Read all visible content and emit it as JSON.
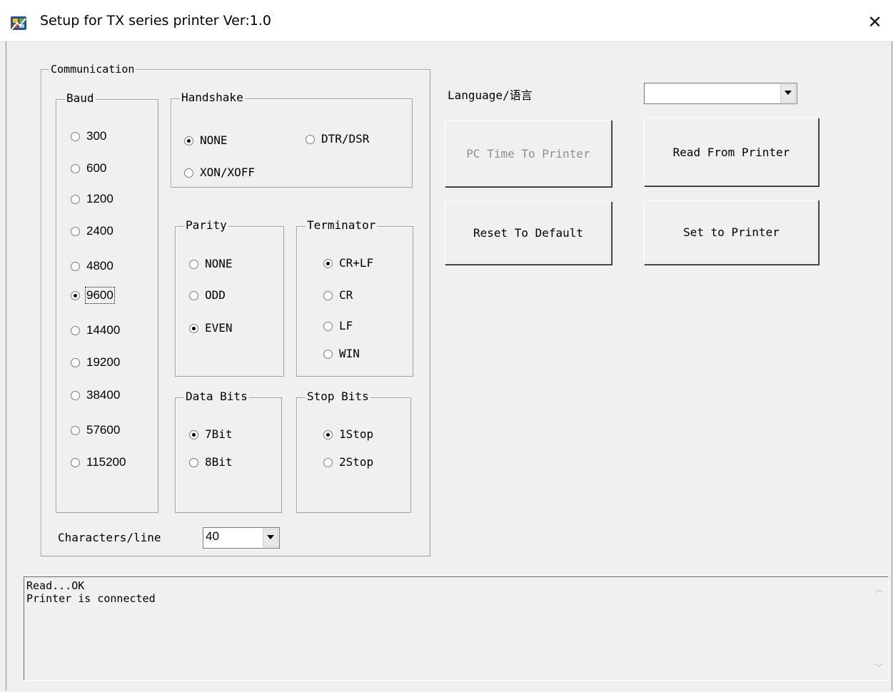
{
  "window": {
    "title": "Setup for TX series printer Ver:1.0",
    "close_glyph": "✕",
    "icon": "printer-app-icon"
  },
  "communication": {
    "caption": "Communication",
    "baud": {
      "caption": "Baud",
      "options": [
        "300",
        "600",
        "1200",
        "2400",
        "4800",
        "9600",
        "14400",
        "19200",
        "38400",
        "57600",
        "115200"
      ],
      "selected": "9600"
    },
    "handshake": {
      "caption": "Handshake",
      "options": [
        "NONE",
        "DTR/DSR",
        "XON/XOFF"
      ],
      "selected": "NONE"
    },
    "parity": {
      "caption": "Parity",
      "options": [
        "NONE",
        "ODD",
        "EVEN"
      ],
      "selected": "EVEN"
    },
    "terminator": {
      "caption": "Terminator",
      "options": [
        "CR+LF",
        "CR",
        "LF",
        "WIN"
      ],
      "selected": "CR+LF"
    },
    "data_bits": {
      "caption": "Data Bits",
      "options": [
        "7Bit",
        "8Bit"
      ],
      "selected": "7Bit"
    },
    "stop_bits": {
      "caption": "Stop Bits",
      "options": [
        "1Stop",
        "2Stop"
      ],
      "selected": "1Stop"
    },
    "characters_per_line": {
      "label": "Characters/line",
      "value": "40"
    }
  },
  "language": {
    "label": "Language/语言",
    "value": ""
  },
  "buttons": {
    "pc_time": "PC Time To Printer",
    "read": "Read From Printer",
    "reset": "Reset To Default",
    "set": "Set to Printer"
  },
  "log": {
    "lines": [
      "Read...OK",
      "Printer is connected"
    ]
  }
}
